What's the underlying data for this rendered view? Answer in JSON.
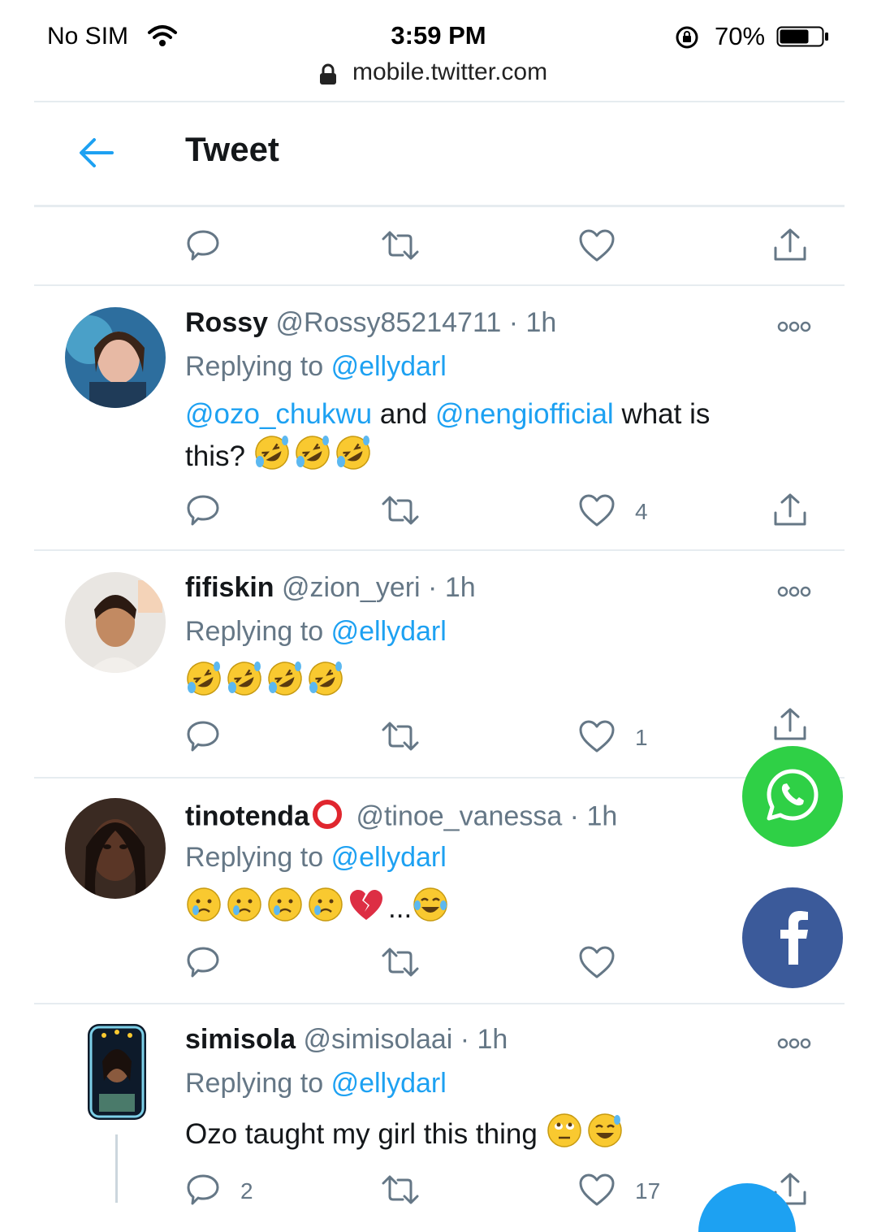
{
  "status_bar": {
    "carrier": "No SIM",
    "time": "3:59 PM",
    "url": "mobile.twitter.com",
    "battery_percent": "70%",
    "battery_level": 0.7
  },
  "header": {
    "title": "Tweet"
  },
  "replying_label": "Replying to",
  "tweets": [
    {
      "name": "Rossy",
      "handle": "@Rossy85214711 · 1h",
      "reply_to": "@ellydarl",
      "mentions": [
        "@ozo_chukwu",
        "@nengiofficial"
      ],
      "and_text": " and ",
      "body_text": " what is this?",
      "likes": "4"
    },
    {
      "name": "fifiskin",
      "handle": "@zion_yeri · 1h",
      "reply_to": "@ellydarl",
      "likes": "1"
    },
    {
      "name": "tinotenda",
      "handle": "@tinoe_vanessa · 1h",
      "reply_to": "@ellydarl",
      "ellipsis": "...",
      "likes": ""
    },
    {
      "name": "simisola",
      "handle": "@simisolaai · 1h",
      "reply_to": "@ellydarl",
      "body_text": "Ozo taught my girl this thing ",
      "replies": "2",
      "likes": "17"
    }
  ],
  "colors": {
    "accent": "#1da1f2",
    "secondary_text": "#657786",
    "whatsapp": "#2fd046",
    "facebook": "#3b5a9a"
  },
  "icons": [
    "back-arrow-icon",
    "reply-icon",
    "retweet-icon",
    "like-icon",
    "share-icon",
    "more-icon",
    "whatsapp-icon",
    "facebook-icon",
    "wifi-icon",
    "lock-icon",
    "orientation-lock-icon",
    "battery-icon"
  ]
}
